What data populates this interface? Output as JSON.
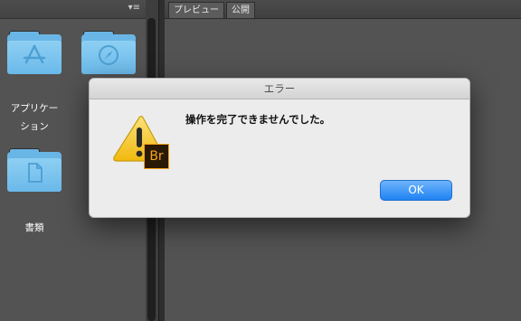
{
  "left_panel": {
    "menu_icon": "panel-menu-icon",
    "folders": [
      {
        "icon": "app-store-icon",
        "label_line1": "アプリケー",
        "label_line2": "ション"
      },
      {
        "icon": "safari-compass-icon",
        "label": ""
      },
      {
        "icon": "document-icon",
        "label": "書類"
      }
    ]
  },
  "right_panel": {
    "tabs": [
      "プレビュー",
      "公開"
    ]
  },
  "dialog": {
    "title": "エラー",
    "message": "操作を完了できませんでした。",
    "ok_label": "OK",
    "app_badge": "Br",
    "icon": "warning-triangle-icon",
    "accent_color": "#1f82f2"
  }
}
